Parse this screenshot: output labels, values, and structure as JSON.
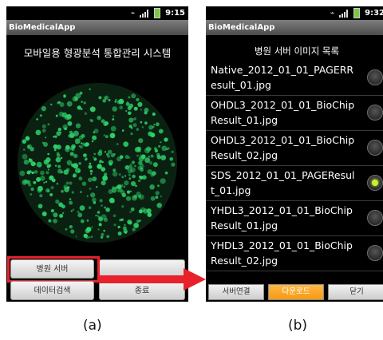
{
  "colors": {
    "highlight": "#e8212b",
    "selected_radio": "#c8f230",
    "active_button": "#f79a10",
    "micro_dots": "#2fd16a"
  },
  "phone_a": {
    "status_time": "9:15",
    "app_title": "BioMedicalApp",
    "heading": "모바일용 형광분석 통합관리 시스템",
    "buttons": {
      "hospital_server": "병원 서버",
      "data_search": "데이터검색",
      "exit": "종료"
    }
  },
  "phone_b": {
    "status_time": "9:32",
    "app_title": "BioMedicalApp",
    "heading": "병원 서버 이미지 목록",
    "files": [
      {
        "name": "Native_2012_01_01_PAGERResult_01.jpg",
        "selected": false
      },
      {
        "name": "OHDL3_2012_01_01_BioChipResult_01.jpg",
        "selected": false
      },
      {
        "name": "OHDL3_2012_01_01_BioChipResult_02.jpg",
        "selected": false
      },
      {
        "name": "SDS_2012_01_01_PAGEResult_01.jpg",
        "selected": true
      },
      {
        "name": "YHDL3_2012_01_01_BioChipResult_01.jpg",
        "selected": false
      },
      {
        "name": "YHDL3_2012_01_01_BioChipResult_02.jpg",
        "selected": false
      }
    ],
    "buttons": {
      "connect": "서버연결",
      "download": "다운로드",
      "close": "닫기"
    }
  },
  "captions": {
    "a": "(a)",
    "b": "(b)"
  }
}
